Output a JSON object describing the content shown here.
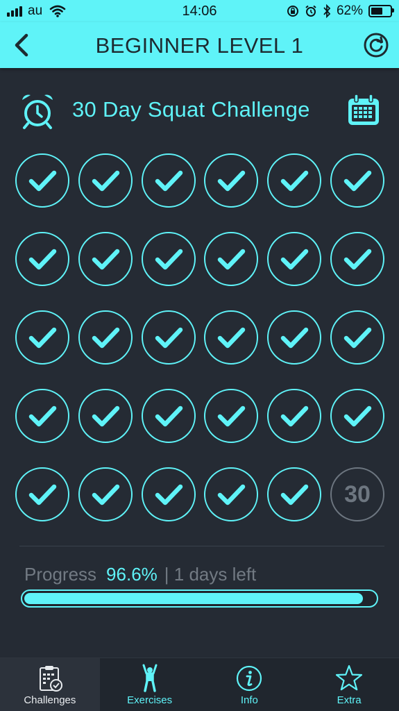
{
  "status_bar": {
    "carrier": "au",
    "time": "14:06",
    "battery": "62%"
  },
  "nav": {
    "title": "BEGINNER LEVEL 1",
    "back_icon": "chevron-left-icon",
    "reset_icon": "refresh-icon"
  },
  "challenge": {
    "title": "30 Day Squat Challenge",
    "alarm_icon": "alarm-clock-icon",
    "calendar_icon": "calendar-icon"
  },
  "days": {
    "completed": 29,
    "total": 30,
    "pending_label": "30"
  },
  "progress": {
    "label": "Progress",
    "percent": "96.6%",
    "days_left": "| 1 days left",
    "fraction": 0.966
  },
  "tabs": [
    {
      "label": "Challenges",
      "icon": "clipboard-check-icon",
      "active": true
    },
    {
      "label": "Exercises",
      "icon": "person-exercise-icon",
      "active": false
    },
    {
      "label": "Info",
      "icon": "info-icon",
      "active": false
    },
    {
      "label": "Extra",
      "icon": "star-icon",
      "active": false
    }
  ],
  "colors": {
    "accent": "#5ff3f8",
    "background": "#252b34",
    "muted": "#6d7680"
  }
}
